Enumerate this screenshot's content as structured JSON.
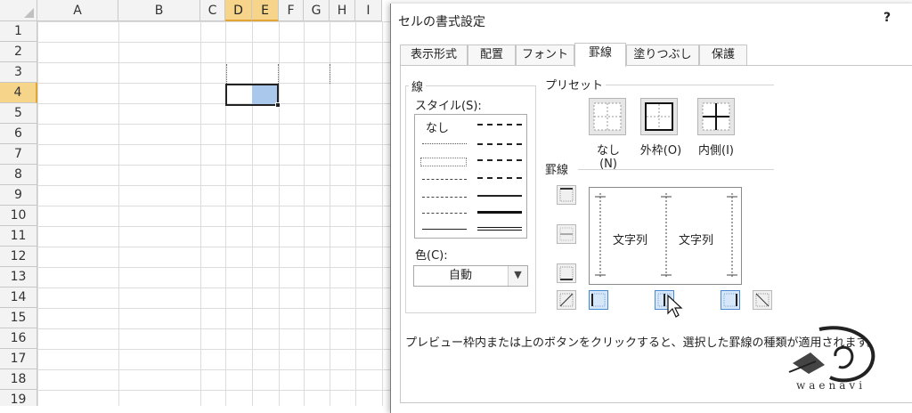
{
  "sheet": {
    "columns": [
      "A",
      "B",
      "C",
      "D",
      "E",
      "F",
      "G",
      "H",
      "I"
    ],
    "rows": [
      "1",
      "2",
      "3",
      "4",
      "5",
      "6",
      "7",
      "8",
      "9",
      "10",
      "11",
      "12",
      "13",
      "14",
      "15",
      "16",
      "17",
      "18",
      "19"
    ]
  },
  "dialog": {
    "title": "セルの書式設定",
    "help": "?",
    "tabs": [
      "表示形式",
      "配置",
      "フォント",
      "罫線",
      "塗りつぶし",
      "保護"
    ],
    "active_tab": "罫線",
    "line_group": {
      "legend": "線",
      "style_label": "スタイル(S):",
      "none_label": "なし",
      "color_label": "色(C):",
      "color_value": "自動"
    },
    "presets": {
      "legend": "プリセット",
      "items": [
        "なし(N)",
        "外枠(O)",
        "内側(I)"
      ]
    },
    "border": {
      "legend": "罫線",
      "preview_texts": [
        "文字列",
        "文字列"
      ]
    },
    "hint": "プレビュー枠内または上のボタンをクリックすると、選択した罫線の種類が適用されます。"
  },
  "watermark": {
    "text": "waenavi"
  },
  "colors": {
    "selected_header": "#f6d58a",
    "selection_fill": "#a9c8ec",
    "active_button": "#d6e7fa"
  }
}
